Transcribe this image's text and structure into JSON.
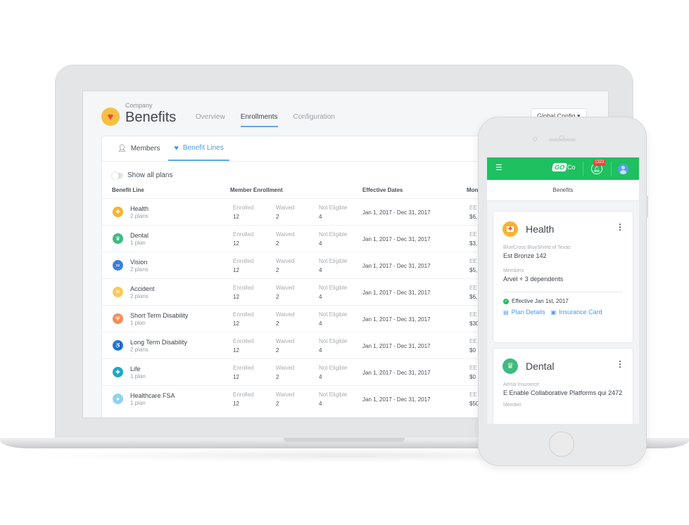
{
  "app": {
    "company_label": "Company",
    "title": "Benefits",
    "nav_tabs": [
      {
        "label": "Overview",
        "active": false
      },
      {
        "label": "Enrollments",
        "active": true
      },
      {
        "label": "Configuration",
        "active": false
      }
    ],
    "global_config": "Global Config ▾"
  },
  "card": {
    "tabs": [
      {
        "label": "Members",
        "icon": "person-icon",
        "active": false
      },
      {
        "label": "Benefit Lines",
        "icon": "heart-icon",
        "active": true
      }
    ],
    "toggle_label": "Show all plans",
    "columns": {
      "benefit_line": "Benefit Line",
      "member_enrollment": "Member Enrollment",
      "effective_dates": "Effective Dates",
      "monthly": "Mon"
    },
    "stat_labels": {
      "enrolled": "Enrolled",
      "waived": "Waived",
      "not_eligible": "Not Eligible"
    },
    "rows": [
      {
        "name": "Health",
        "plans": "2 plans",
        "icon": "first-aid-kit",
        "color": "#f5b335",
        "glyph": "✚",
        "enrolled": "12",
        "waived": "2",
        "not_eligible": "4",
        "dates": "Jan 1, 2017 - Dec 31, 2017",
        "ee_label": "EE",
        "ee_value": "$6,"
      },
      {
        "name": "Dental",
        "plans": "1 plan",
        "icon": "tooth",
        "color": "#3dbb82",
        "glyph": "♛",
        "enrolled": "12",
        "waived": "2",
        "not_eligible": "4",
        "dates": "Jan 1, 2017 - Dec 31, 2017",
        "ee_label": "EE",
        "ee_value": "$3,"
      },
      {
        "name": "Vision",
        "plans": "2 plans",
        "icon": "glasses",
        "color": "#3d7fd9",
        "glyph": "∞",
        "enrolled": "12",
        "waived": "2",
        "not_eligible": "4",
        "dates": "Jan 1, 2017 - Dec 31, 2017",
        "ee_label": "EE",
        "ee_value": "$5,"
      },
      {
        "name": "Accident",
        "plans": "2 plans",
        "icon": "bandage",
        "color": "#fbc95c",
        "glyph": "✕",
        "enrolled": "12",
        "waived": "2",
        "not_eligible": "4",
        "dates": "Jan 1, 2017 - Dec 31, 2017",
        "ee_label": "EE",
        "ee_value": "$6,"
      },
      {
        "name": "Short Term Disability",
        "plans": "1 plan",
        "icon": "crutch",
        "color": "#f0905a",
        "glyph": "Ψ",
        "enrolled": "12",
        "waived": "2",
        "not_eligible": "4",
        "dates": "Jan 1, 2017 - Dec 31, 2017",
        "ee_label": "EE",
        "ee_value": "$30"
      },
      {
        "name": "Long Term Disability",
        "plans": "2 plans",
        "icon": "wheelchair",
        "color": "#1a79d6",
        "glyph": "♿",
        "enrolled": "12",
        "waived": "2",
        "not_eligible": "4",
        "dates": "Jan 1, 2017 - Dec 31, 2017",
        "ee_label": "EE",
        "ee_value": "$0"
      },
      {
        "name": "Life",
        "plans": "1 plan",
        "icon": "lifebuoy",
        "color": "#22a6c4",
        "glyph": "✚",
        "enrolled": "12",
        "waived": "2",
        "not_eligible": "4",
        "dates": "Jan 1, 2017 - Dec 31, 2017",
        "ee_label": "EE",
        "ee_value": "$0"
      },
      {
        "name": "Healthcare FSA",
        "plans": "1 plan",
        "icon": "piggy-bank",
        "color": "#8fd3ee",
        "glyph": "●",
        "enrolled": "12",
        "waived": "2",
        "not_eligible": "4",
        "dates": "Jan 1, 2017 - Dec 31, 2017",
        "ee_label": "EE",
        "ee_value": "$50"
      }
    ]
  },
  "mobile": {
    "brand_go": "GO",
    "brand_co": "Co",
    "notification_count": "1323",
    "page_title": "Benefits",
    "brand_color": "#1ec060",
    "cards": [
      {
        "name": "Health",
        "icon": "first-aid-kit",
        "color": "#f5b335",
        "glyph": "✚",
        "provider": "BlueCross BlueShield of Texas",
        "plan": "Est Bronze 142",
        "members_label": "Members",
        "members": "Arvel + 3 dependents",
        "effective": "Effective Jan 1st, 2017",
        "links": [
          "Plan Details",
          "Insurance Card"
        ]
      },
      {
        "name": "Dental",
        "icon": "tooth",
        "color": "#3dbb82",
        "glyph": "♛",
        "provider": "Aetna Insurance",
        "plan": "E Enable Collaborative Platforms qui 2472",
        "members_label": "Member"
      }
    ]
  }
}
